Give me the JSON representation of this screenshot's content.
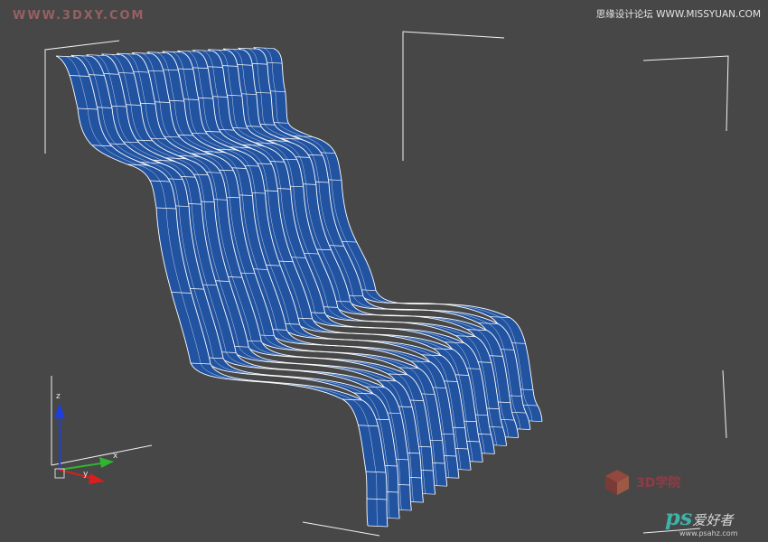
{
  "viewport": {
    "background": "#474747",
    "object": "wavy slat chair / lounge mesh",
    "mesh_color": "#2153a1",
    "mesh_dark": "#16387a",
    "wire_color": "#ffffff",
    "bbox_color": "#f2f2f2"
  },
  "gizmo": {
    "z_label": "z",
    "x_label": "x",
    "y_label": "y",
    "x_color": "#d81e1e",
    "y_color": "#2fb52f",
    "z_color": "#1d3fe0"
  },
  "watermarks": {
    "top_left": "WWW.3DXY.COM",
    "top_right": "思缘设计论坛 WWW.MISSYUAN.COM",
    "bottom_3d": "3D学院",
    "ps_logo": "ps",
    "ps_text": "爱好者",
    "ps_url": "www.psahz.com"
  }
}
